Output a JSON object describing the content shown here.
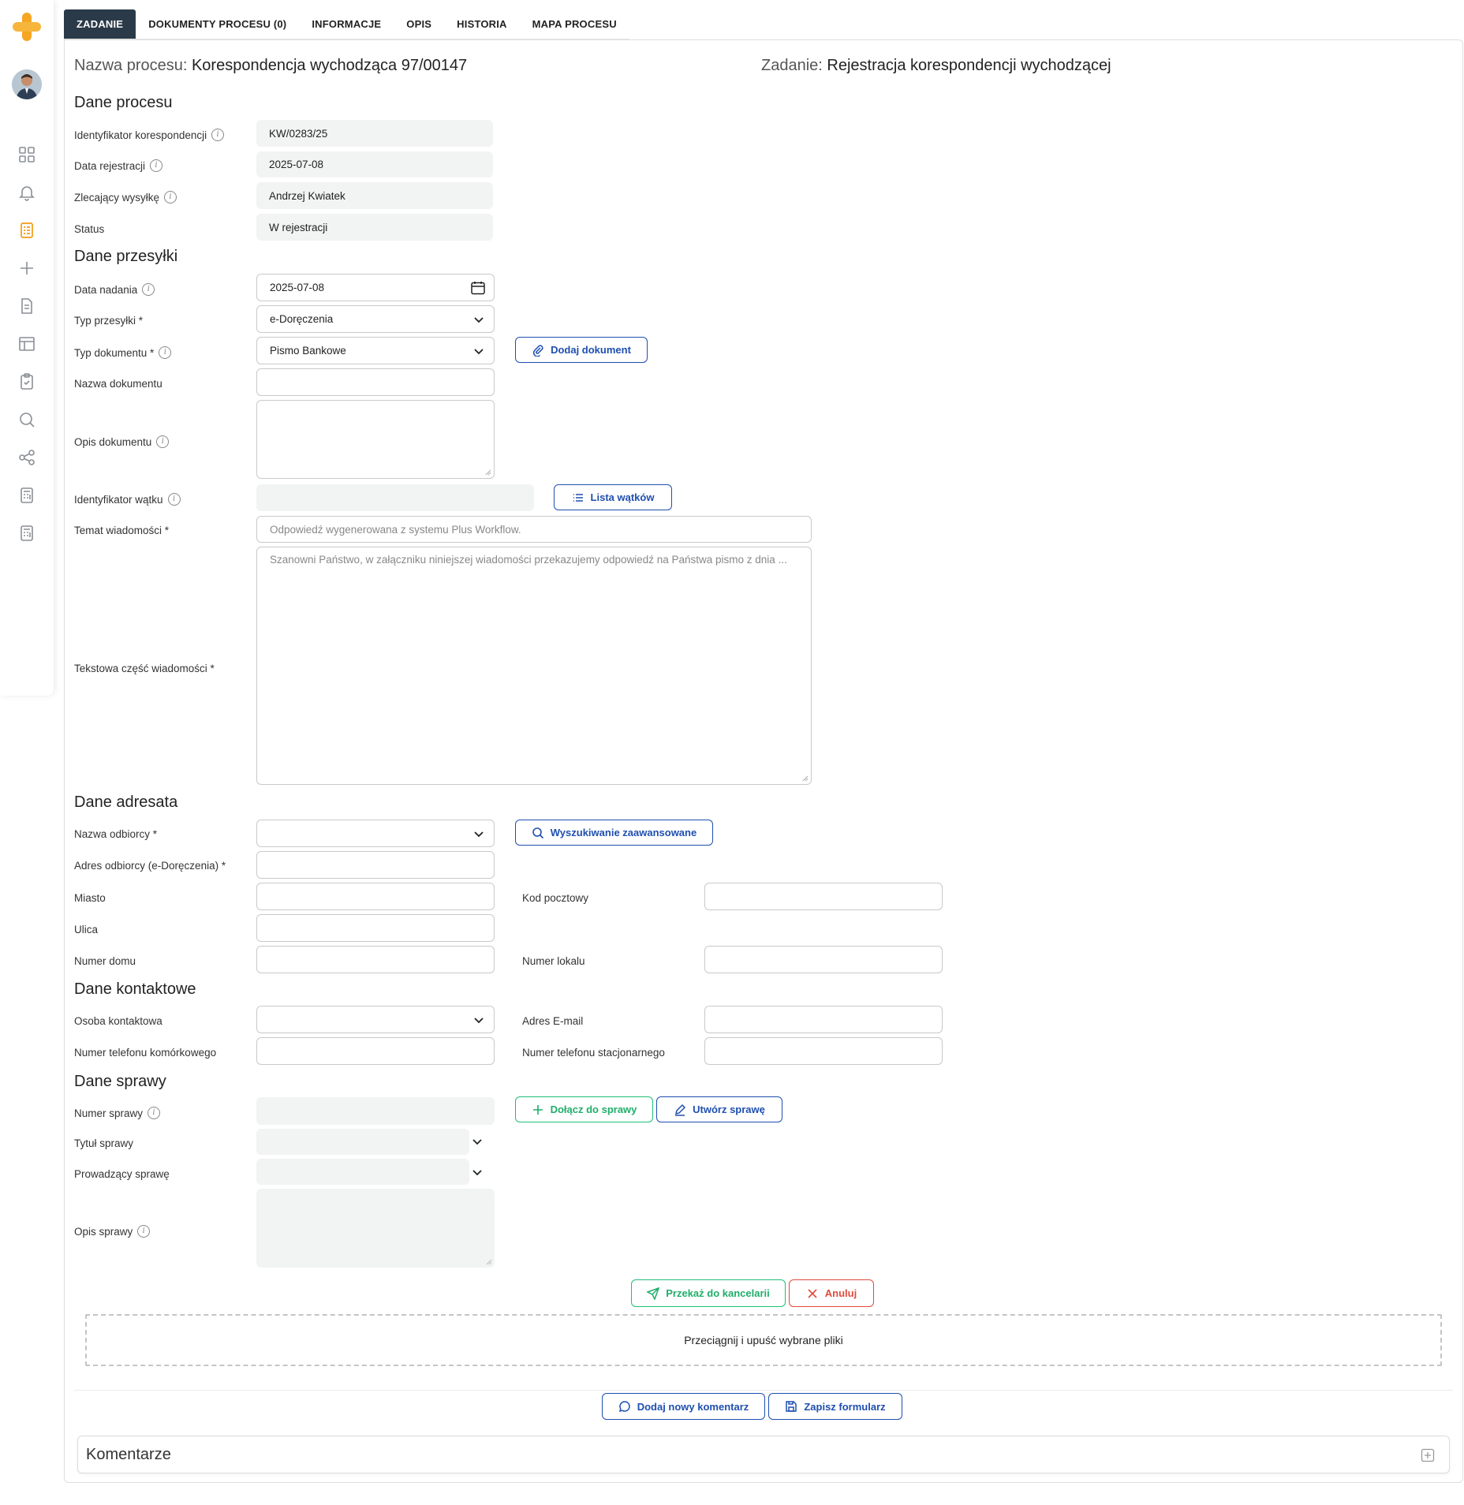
{
  "tabs": [
    {
      "label": "ZADANIE",
      "active": true
    },
    {
      "label": "DOKUMENTY PROCESU (0)"
    },
    {
      "label": "INFORMACJE"
    },
    {
      "label": "OPIS"
    },
    {
      "label": "HISTORIA"
    },
    {
      "label": "MAPA PROCESU"
    }
  ],
  "header": {
    "process_label": "Nazwa procesu:",
    "process_value": "Korespondencja wychodząca 97/00147",
    "task_label": "Zadanie:",
    "task_value": "Rejestracja korespondencji wychodzącej"
  },
  "sections": {
    "process": "Dane procesu",
    "shipment": "Dane przesyłki",
    "recipient": "Dane adresata",
    "contact": "Dane kontaktowe",
    "case": "Dane sprawy"
  },
  "process_data": {
    "id_label": "Identyfikator korespondencji",
    "id_value": "KW/0283/25",
    "date_label": "Data rejestracji",
    "date_value": "2025-07-08",
    "requester_label": "Zlecający wysyłkę",
    "requester_value": "Andrzej Kwiatek",
    "status_label": "Status",
    "status_value": "W rejestracji"
  },
  "shipment": {
    "send_date_label": "Data nadania",
    "send_date_value": "2025-07-08",
    "type_label": "Typ przesyłki *",
    "type_value": "e-Doręczenia",
    "doc_type_label": "Typ dokumentu *",
    "doc_type_value": "Pismo Bankowe",
    "add_doc_button": "Dodaj dokument",
    "doc_name_label": "Nazwa dokumentu",
    "doc_name_value": "",
    "doc_desc_label": "Opis dokumentu",
    "doc_desc_value": "",
    "thread_id_label": "Identyfikator wątku",
    "thread_id_value": "",
    "thread_list_button": "Lista wątków",
    "subject_label": "Temat wiadomości *",
    "subject_placeholder": "Odpowiedź wygenerowana z systemu Plus Workflow.",
    "body_label": "Tekstowa część wiadomości *",
    "body_placeholder": "Szanowni Państwo, w załączniku niniejszej wiadomości przekazujemy odpowiedź na Państwa pismo z dnia ..."
  },
  "recipient": {
    "name_label": "Nazwa odbiorcy *",
    "advanced_search_button": "Wyszukiwanie zaawansowane",
    "address_label": "Adres odbiorcy (e-Doręczenia) *",
    "city_label": "Miasto",
    "postal_label": "Kod pocztowy",
    "street_label": "Ulica",
    "house_label": "Numer domu",
    "flat_label": "Numer lokalu"
  },
  "contact": {
    "person_label": "Osoba kontaktowa",
    "email_label": "Adres E-mail",
    "mobile_label": "Numer telefonu komórkowego",
    "landline_label": "Numer telefonu stacjonarnego"
  },
  "case": {
    "number_label": "Numer sprawy",
    "join_button": "Dołącz do sprawy",
    "create_button": "Utwórz sprawę",
    "title_label": "Tytuł sprawy",
    "owner_label": "Prowadzący sprawę",
    "desc_label": "Opis sprawy"
  },
  "actions": {
    "forward_button": "Przekaż do kancelarii",
    "cancel_button": "Anuluj",
    "dropzone_text": "Przeciągnij i upuść wybrane pliki",
    "add_comment_button": "Dodaj nowy komentarz",
    "save_form_button": "Zapisz formularz"
  },
  "comments": {
    "title": "Komentarze"
  },
  "colors": {
    "accent": "#1f4fb0",
    "active_tab": "#2b3a48",
    "green": "#1fbf76",
    "red": "#e04b3c",
    "logo": "#f5a623",
    "active_nav": "#f39c12"
  },
  "nav_icons": [
    "grid-icon",
    "bell-icon",
    "task-list-icon",
    "plus-icon",
    "document-icon",
    "table-icon",
    "clipboard-check-icon",
    "search-icon",
    "share-icon",
    "calculator-icon",
    "calculator-icon"
  ]
}
